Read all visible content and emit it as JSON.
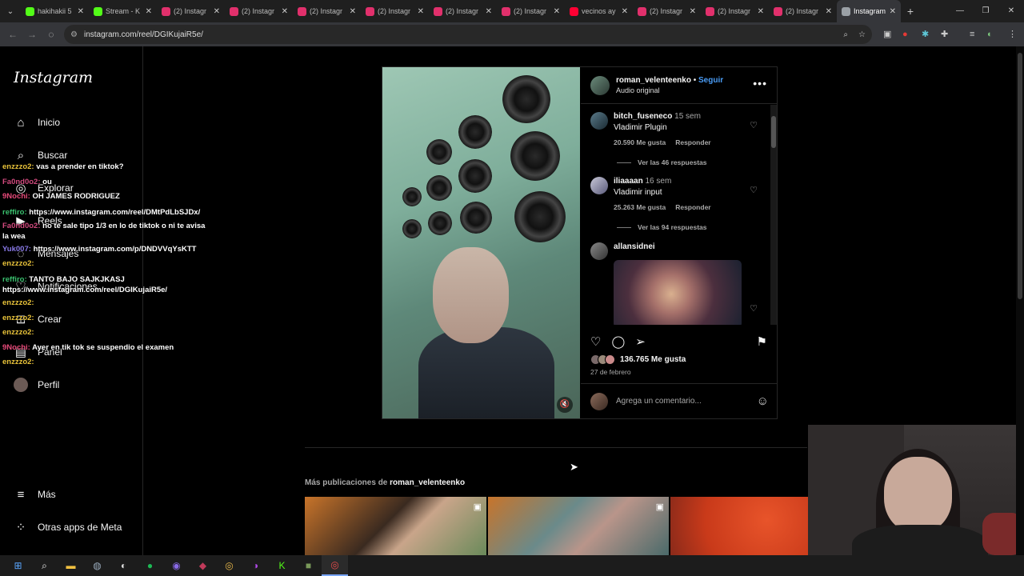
{
  "browser": {
    "tabs": [
      {
        "title": "hakihakii 5",
        "color": "#53fc18"
      },
      {
        "title": "Stream - K",
        "color": "#53fc18"
      },
      {
        "title": "(2) Instagr",
        "color": "#e1306c"
      },
      {
        "title": "(2) Instagr",
        "color": "#e1306c"
      },
      {
        "title": "(2) Instagr",
        "color": "#e1306c"
      },
      {
        "title": "(2) Instagr",
        "color": "#e1306c"
      },
      {
        "title": "(2) Instagr",
        "color": "#e1306c"
      },
      {
        "title": "(2) Instagr",
        "color": "#e1306c"
      },
      {
        "title": "vecinos ay",
        "color": "#ff0033"
      },
      {
        "title": "(2) Instagr",
        "color": "#e1306c"
      },
      {
        "title": "(2) Instagr",
        "color": "#e1306c"
      },
      {
        "title": "(2) Instagr",
        "color": "#e1306c"
      },
      {
        "title": "Instagram",
        "color": "#9aa0a6"
      }
    ],
    "url": "instagram.com/reel/DGIKujaiR5e/"
  },
  "sidebar": {
    "logo": "Instagram",
    "items": [
      {
        "label": "Inicio",
        "icon": "home-icon"
      },
      {
        "label": "Buscar",
        "icon": "search-icon"
      },
      {
        "label": "Explorar",
        "icon": "compass-icon"
      },
      {
        "label": "Reels",
        "icon": "reels-icon"
      },
      {
        "label": "Mensajes",
        "icon": "messenger-icon"
      },
      {
        "label": "Notificaciones",
        "icon": "heart-icon"
      },
      {
        "label": "Crear",
        "icon": "plus-square-icon"
      },
      {
        "label": "Panel",
        "icon": "dashboard-icon"
      },
      {
        "label": "Perfil",
        "icon": "avatar"
      }
    ],
    "more": "Más",
    "meta": "Otras apps de Meta"
  },
  "chat": [
    {
      "user": "enzzzo2:",
      "msg": "vas a prender en tiktok?",
      "cls": "u1"
    },
    {
      "user": "Fa0nd0o2:",
      "msg": "ou",
      "cls": "u2"
    },
    {
      "user": "9Nochi:",
      "msg": "OH JAMES RODRIGUEZ",
      "cls": "u3"
    },
    {
      "user": "reffiro:",
      "msg": "https://www.instagram.com/reel/DMtPdLbSJDx/",
      "cls": "u4"
    },
    {
      "user": "Fa0nd0o2:",
      "msg": "no te sale tipo 1/3 en lo de tiktok o ni te avisa la wea",
      "cls": "u2"
    },
    {
      "user": "Yuk007:",
      "msg": "https://www.instagram.com/p/DNDVVqYsKTT",
      "cls": "u5"
    },
    {
      "user": "enzzzo2:",
      "msg": "",
      "cls": "u1"
    },
    {
      "user": "reffiro:",
      "msg": "TANTO BAJO SAJKJKASJ https://www.instagram.com/reel/DGIKujaiR5e/",
      "cls": "u4"
    },
    {
      "user": "enzzzo2:",
      "msg": "",
      "cls": "u1"
    },
    {
      "user": "enzzzo2:",
      "msg": "",
      "cls": "u1"
    },
    {
      "user": "enzzzo2:",
      "msg": "",
      "cls": "u1"
    },
    {
      "user": "9Nochi:",
      "msg": "Ayer en tik tok se suspendio el examen",
      "cls": "u3"
    },
    {
      "user": "enzzzo2:",
      "msg": "",
      "cls": "u1"
    }
  ],
  "post": {
    "author": "roman_velenteenko",
    "follow": "Seguir",
    "audio": "Audio original",
    "comments": [
      {
        "user": "bitch_fuseneco",
        "time": "15 sem",
        "text": "Vladimir Plugin",
        "likes": "20.590 Me gusta",
        "reply": "Responder",
        "replies": "Ver las 46 respuestas"
      },
      {
        "user": "iliaaaan",
        "time": "16 sem",
        "text": "Vladimir input",
        "likes": "25.263 Me gusta",
        "reply": "Responder",
        "replies": "Ver las 94 respuestas"
      },
      {
        "user": "allansidnei",
        "time": "",
        "text": "",
        "likes": "",
        "reply": "",
        "replies": ""
      }
    ],
    "like_count": "136.765 Me gusta",
    "date": "27 de febrero",
    "add_comment": "Agrega un comentario..."
  },
  "more_posts": {
    "prefix": "Más publicaciones de",
    "user": "roman_velenteenko"
  },
  "colors": {
    "accent": "#4a9cf5",
    "bg": "#000000",
    "muted": "#a8a8a8"
  }
}
